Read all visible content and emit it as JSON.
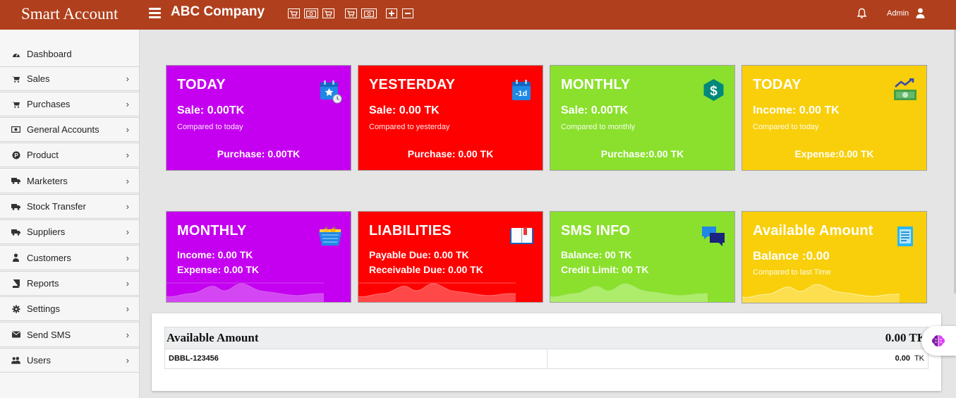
{
  "app": {
    "brand": "Smart Account",
    "company": "ABC Company"
  },
  "quick_actions": [
    "cart-icon",
    "money-icon",
    "cart-icon",
    "cart-icon",
    "money-icon",
    "plus-icon",
    "minus-icon"
  ],
  "header": {
    "user_label": "Admin"
  },
  "sidebar": {
    "items": [
      {
        "label": "Dashboard",
        "icon": "dashboard-icon"
      },
      {
        "label": "Sales",
        "icon": "cart-icon"
      },
      {
        "label": "Purchases",
        "icon": "cart-icon"
      },
      {
        "label": "General Accounts",
        "icon": "money-icon"
      },
      {
        "label": "Product",
        "icon": "product-icon"
      },
      {
        "label": "Marketers",
        "icon": "truck-icon"
      },
      {
        "label": "Stock Transfer",
        "icon": "truck-icon"
      },
      {
        "label": "Suppliers",
        "icon": "truck-icon"
      },
      {
        "label": "Customers",
        "icon": "users-icon"
      },
      {
        "label": "Reports",
        "icon": "book-icon"
      },
      {
        "label": "Settings",
        "icon": "gear-icon"
      },
      {
        "label": "Send SMS",
        "icon": "envelope-icon"
      },
      {
        "label": "Users",
        "icon": "users-icon"
      }
    ]
  },
  "cards_row1": [
    {
      "title": "TODAY",
      "line1": "Sale: 0.00TK",
      "line2": "Compared to today",
      "footer": "Purchase: 0.00TK",
      "color": "#c500f0",
      "icon": "calendar-star-icon"
    },
    {
      "title": "YESTERDAY",
      "line1": "Sale: 0.00 TK",
      "line2": "Compared to yesterday",
      "footer": "Purchase: 0.00 TK",
      "color": "#fe0000",
      "icon": "calendar-minus-icon"
    },
    {
      "title": "MONTHLY",
      "line1": "Sale: 0.00TK",
      "line2": "Compared to monthly",
      "footer": "Purchase:0.00 TK",
      "color": "#8ae02c",
      "icon": "dollar-icon"
    },
    {
      "title": "TODAY",
      "line1": "Income: 0.00 TK",
      "line2": "Compared to today",
      "footer": "Expense:0.00 TK",
      "color": "#f8cf0a",
      "icon": "cash-trend-icon"
    }
  ],
  "cards_row2": [
    {
      "title": "MONTHLY",
      "line1": "Income: 0.00 TK",
      "line2": "Expense: 0.00 TK",
      "color": "#c500f0",
      "icon": "basket-icon"
    },
    {
      "title": "LIABILITIES",
      "line1": "Payable Due: 0.00 TK",
      "line2": "Receivable Due: 0.00 TK",
      "color": "#fe0000",
      "icon": "open-book-icon"
    },
    {
      "title": "SMS INFO",
      "line1": "Balance: 00 TK",
      "line2": "Credit Limit: 00 TK",
      "color": "#8ae02c",
      "icon": "chat-icon"
    },
    {
      "title": "Available Amount",
      "line1": "Balance :0.00",
      "line2": "Compared to last Time",
      "color": "#f8cf0a",
      "icon": "document-icon"
    }
  ],
  "available": {
    "title": "Available Amount",
    "total": "0.00 TK",
    "rows": [
      {
        "account": "DBBL-123456",
        "amount": "0.00",
        "unit": "TK"
      }
    ]
  }
}
